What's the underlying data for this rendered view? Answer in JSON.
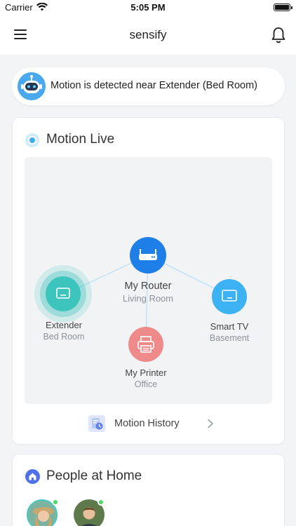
{
  "status_bar": {
    "carrier": "Carrier",
    "time": "5:05 PM"
  },
  "header": {
    "title": "sensify",
    "menu_icon": "hamburger-menu-icon",
    "bell_icon": "bell-icon"
  },
  "notification": {
    "text": "Motion is detected near Extender (Bed Room)",
    "icon": "robot-icon"
  },
  "motion_live": {
    "title": "Motion Live",
    "nodes": [
      {
        "name": "My Router",
        "room": "Living Room",
        "color": "#1f7fe8",
        "icon": "router-icon"
      },
      {
        "name": "Extender",
        "room": "Bed Room",
        "color": "#3dc4bd",
        "icon": "extender-icon",
        "active": true
      },
      {
        "name": "Smart TV",
        "room": "Basement",
        "color": "#3db2f3",
        "icon": "tv-icon"
      },
      {
        "name": "My Printer",
        "room": "Office",
        "color": "#ef8a8a",
        "icon": "printer-icon"
      }
    ],
    "history_label": "Motion History"
  },
  "people": {
    "title": "People at Home",
    "members": [
      {
        "avatar": "avatar-woman",
        "online": true
      },
      {
        "avatar": "avatar-man",
        "online": true
      }
    ]
  },
  "colors": {
    "accent": "#3aaef0",
    "online": "#4cd964",
    "home": "#4f73e6"
  }
}
